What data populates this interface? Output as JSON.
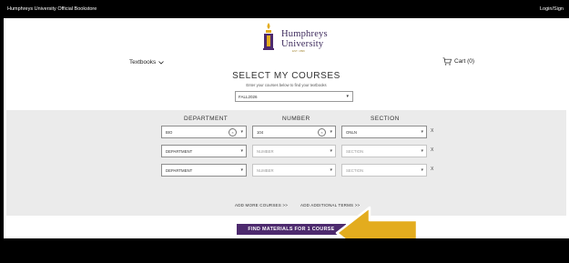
{
  "top_bar": {
    "store_name": "Humphreys University Official Bookstore",
    "login_link": "Login/Sign"
  },
  "brand": {
    "name_line1": "Humphreys",
    "name_line2": "University",
    "tagline": "EST. 1896"
  },
  "nav": {
    "textbooks_label": "Textbooks",
    "cart_label": "Cart (0)"
  },
  "page": {
    "title": "SELECT MY COURSES",
    "subtitle": "Enter your courses below to find your textbooks"
  },
  "term": {
    "selected": "FALL2026"
  },
  "columns": {
    "department": "DEPARTMENT",
    "number": "NUMBER",
    "section": "SECTION"
  },
  "rows": [
    {
      "department": "BIO",
      "number": "104",
      "section": "ONLN"
    },
    {
      "department": "DEPARTMENT",
      "number": "NUMBER",
      "section": "SECTION"
    },
    {
      "department": "DEPARTMENT",
      "number": "NUMBER",
      "section": "SECTION"
    }
  ],
  "row_remove_glyph": "X",
  "links": {
    "add_more": "ADD MORE COURSES >>",
    "add_terms": "ADD ADDITIONAL TERMS >>"
  },
  "find_button": "FIND MATERIALS FOR 1 COURSE",
  "colors": {
    "brand_purple": "#4d2a6e",
    "arrow_gold": "#e3ac1e",
    "panel_gray": "#ebebeb"
  },
  "icons": {
    "cart": "cart-icon",
    "chevron": "chevron-down-icon",
    "clear": "clear-icon",
    "logo": "university-seal-icon"
  }
}
